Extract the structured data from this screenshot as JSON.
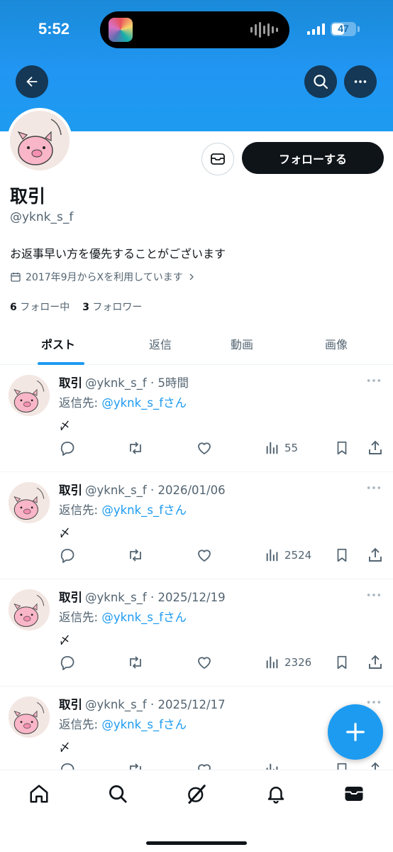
{
  "status_bar": {
    "time": "5:52",
    "battery": "47"
  },
  "header": {
    "back_icon": "arrow-left-icon",
    "search_icon": "search-icon",
    "more_icon": "more-horizontal-icon"
  },
  "profile": {
    "display_name": "取引",
    "handle": "@yknk_s_f",
    "bio": "お返事早い方を優先することがございます",
    "joined": "2017年9月からXを利用しています",
    "following_count": "6",
    "following_label": "フォロー中",
    "followers_count": "3",
    "followers_label": "フォロワー",
    "follow_button": "フォローする"
  },
  "tabs": [
    {
      "label": "ポスト",
      "active": true
    },
    {
      "label": "返信",
      "active": false
    },
    {
      "label": "動画",
      "active": false
    },
    {
      "label": "画像",
      "active": false
    }
  ],
  "posts": [
    {
      "name": "取引",
      "meta": "@yknk_s_f · 5時間",
      "reply_prefix": "返信先: ",
      "reply_to": "@yknk_s_fさん",
      "text": "〆",
      "views": "55"
    },
    {
      "name": "取引",
      "meta": "@yknk_s_f · 2026/01/06",
      "reply_prefix": "返信先: ",
      "reply_to": "@yknk_s_fさん",
      "text": "〆",
      "views": "2524"
    },
    {
      "name": "取引",
      "meta": "@yknk_s_f · 2025/12/19",
      "reply_prefix": "返信先: ",
      "reply_to": "@yknk_s_fさん",
      "text": "〆",
      "views": "2326"
    },
    {
      "name": "取引",
      "meta": "@yknk_s_f · 2025/12/17",
      "reply_prefix": "返信先: ",
      "reply_to": "@yknk_s_fさん",
      "text": "〆",
      "views": ""
    }
  ],
  "colors": {
    "accent": "#1d9bf0",
    "text": "#0f1419",
    "muted": "#536471",
    "banner": "#1d9bf0"
  }
}
